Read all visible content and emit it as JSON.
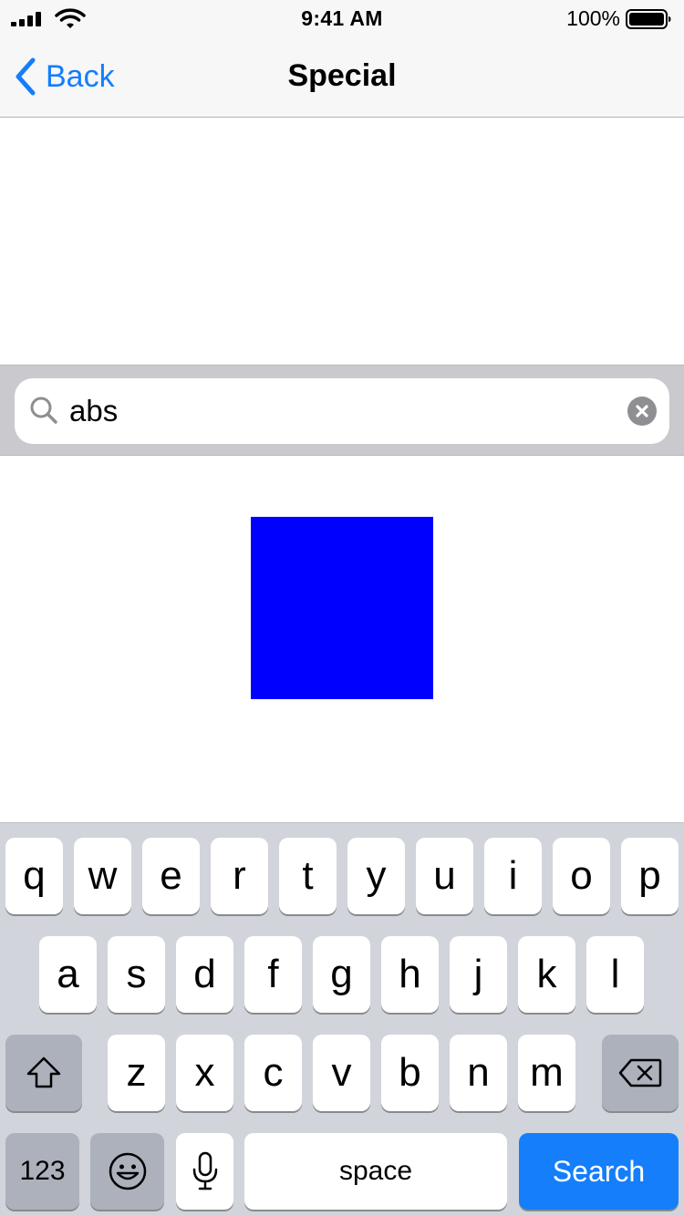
{
  "status_bar": {
    "time": "9:41 AM",
    "battery": "100%"
  },
  "nav": {
    "back_label": "Back",
    "title": "Special"
  },
  "search": {
    "value": "abs"
  },
  "content": {
    "square_color": "#0000ff"
  },
  "keyboard": {
    "row1": [
      "q",
      "w",
      "e",
      "r",
      "t",
      "y",
      "u",
      "i",
      "o",
      "p"
    ],
    "row2": [
      "a",
      "s",
      "d",
      "f",
      "g",
      "h",
      "j",
      "k",
      "l"
    ],
    "row3": [
      "z",
      "x",
      "c",
      "v",
      "b",
      "n",
      "m"
    ],
    "numbers_label": "123",
    "space_label": "space",
    "search_label": "Search",
    "accent_color": "#147efb"
  }
}
